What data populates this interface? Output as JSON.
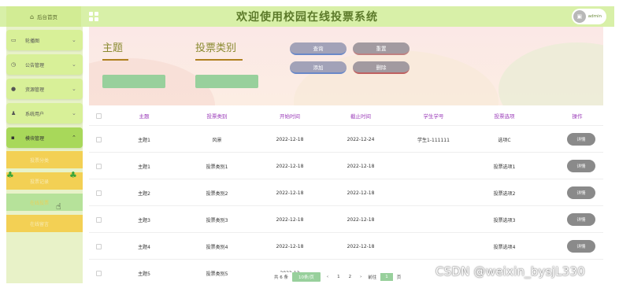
{
  "topbar": {
    "brand_icon": "home-icon",
    "brand_label": "后台首页",
    "title": "欢迎使用校园在线投票系统",
    "user_name": "admin"
  },
  "sidebar": {
    "items": [
      {
        "label": "轮播图",
        "icon": "image-icon"
      },
      {
        "label": "公告管理",
        "icon": "clock-icon"
      },
      {
        "label": "资源管理",
        "icon": "pin-icon"
      },
      {
        "label": "系统用户",
        "icon": "user-icon"
      },
      {
        "label": "模块管理",
        "icon": "grid-icon"
      }
    ],
    "subitems": [
      {
        "label": "投票分类"
      },
      {
        "label": "投票记录"
      },
      {
        "label": "在线投票"
      },
      {
        "label": "在线留言"
      }
    ]
  },
  "search": {
    "field1_label": "主题",
    "field2_label": "投票类别",
    "query_button": "查询",
    "reset_button": "重置",
    "add_button": "添加",
    "delete_button": "删除"
  },
  "table": {
    "columns": [
      "主题",
      "投票类别",
      "开始时间",
      "截止时间",
      "学生学号",
      "投票选项",
      "操作"
    ],
    "rows": [
      {
        "theme": "主题1",
        "category": "风景",
        "start": "2022-12-18",
        "end": "2022-12-24",
        "student": "学生1-111111",
        "option": "选项C",
        "action": "详情"
      },
      {
        "theme": "主题1",
        "category": "投票类别1",
        "start": "2022-12-18",
        "end": "2022-12-18",
        "student": "",
        "option": "投票选项1",
        "action": "详情"
      },
      {
        "theme": "主题2",
        "category": "投票类别2",
        "start": "2022-12-18",
        "end": "2022-12-18",
        "student": "",
        "option": "投票选项2",
        "action": "详情"
      },
      {
        "theme": "主题3",
        "category": "投票类别3",
        "start": "2022-12-18",
        "end": "2022-12-18",
        "student": "",
        "option": "投票选项3",
        "action": "详情"
      },
      {
        "theme": "主题4",
        "category": "投票类别4",
        "start": "2022-12-18",
        "end": "2022-12-18",
        "student": "",
        "option": "投票选项4",
        "action": "详情"
      },
      {
        "theme": "主题5",
        "category": "投票类别5",
        "start": "2022-12",
        "end": "",
        "student": "",
        "option": "",
        "action": ""
      }
    ]
  },
  "pager": {
    "total": "共 6 条",
    "page_size": "10条/页",
    "prev": "‹",
    "page1": "1",
    "page2": "2",
    "next": "›",
    "goto": "前往",
    "page_input": "1",
    "page_suffix": "页"
  },
  "watermark": "CSDN @weixin_bysjL330"
}
